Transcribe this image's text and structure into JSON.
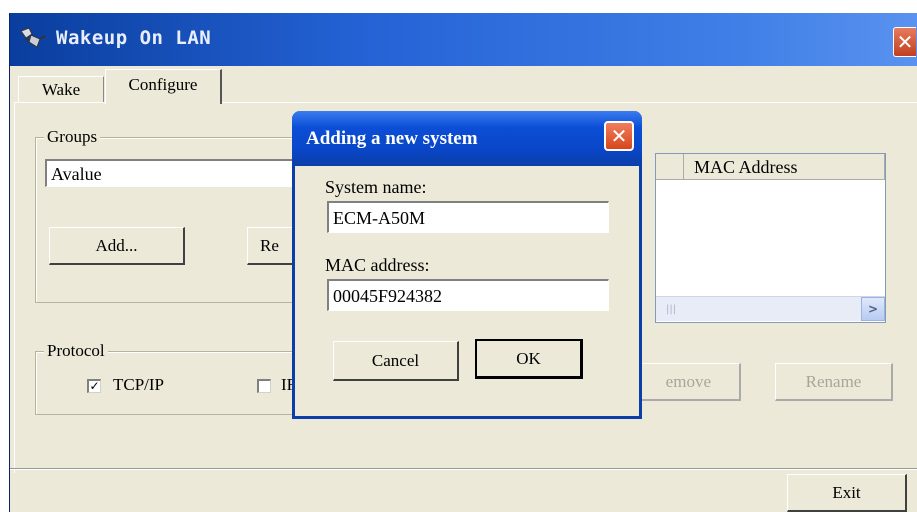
{
  "window": {
    "title": "Wakeup On LAN",
    "close_glyph": "✕"
  },
  "tabs": [
    {
      "label": "Wake",
      "active": false
    },
    {
      "label": "Configure",
      "active": true
    }
  ],
  "groups": {
    "label": "Groups",
    "selected_group": "Avalue",
    "add_button": "Add...",
    "rename_button_partial": "Re"
  },
  "systems": {
    "columns": [
      "",
      "MAC Address"
    ],
    "scroll_grip": "|||",
    "scroll_right_glyph": ">",
    "remove_button_partial": "emove",
    "rename_button": "Rename"
  },
  "protocol": {
    "label": "Protocol",
    "tcpip_label": "TCP/IP",
    "tcpip_checked": true,
    "check_glyph": "✓",
    "second_label_partial": "IF",
    "second_checked": false
  },
  "exit_button": "Exit",
  "dialog": {
    "title": "Adding a new system",
    "close_glyph": "✕",
    "system_name_label": "System name:",
    "system_name_value": "ECM-A50M",
    "mac_label": "MAC address:",
    "mac_value": "00045F924382",
    "cancel_button": "Cancel",
    "ok_button": "OK"
  },
  "colors": {
    "titlebar": "#2563d6",
    "dialog_titlebar": "#0b4ed6",
    "close_red": "#d7461d",
    "window_bg": "#ece9d8"
  }
}
